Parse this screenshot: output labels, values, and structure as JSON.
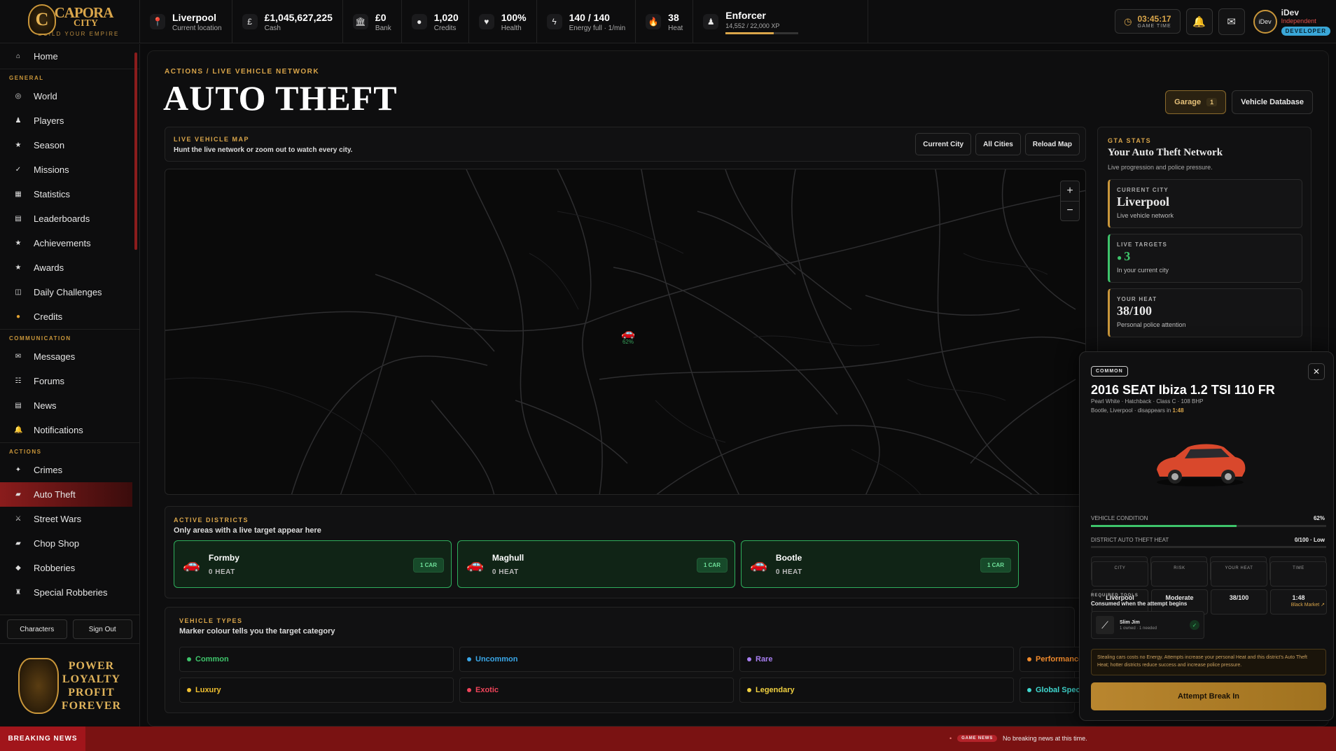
{
  "brand": {
    "name1": "CAPORA",
    "name2": "CITY",
    "tagline": "BUILD YOUR EMPIRE",
    "crest": "C"
  },
  "topbar": {
    "stats": [
      {
        "icon": "location-pin-icon",
        "glyph": "📍",
        "value": "Liverpool",
        "label": "Current location"
      },
      {
        "icon": "pound-icon",
        "glyph": "£",
        "value": "£1,045,627,225",
        "label": "Cash"
      },
      {
        "icon": "bank-icon",
        "glyph": "🏛",
        "value": "£0",
        "label": "Bank"
      },
      {
        "icon": "coin-icon",
        "glyph": "●",
        "value": "1,020",
        "label": "Credits"
      },
      {
        "icon": "heart-icon",
        "glyph": "♥",
        "value": "100%",
        "label": "Health"
      },
      {
        "icon": "energy-icon",
        "glyph": "ϟ",
        "value": "140 / 140",
        "label": "Energy full · 1/min"
      },
      {
        "icon": "flame-icon",
        "glyph": "🔥",
        "value": "38",
        "label": "Heat"
      }
    ],
    "rank": {
      "name": "Enforcer",
      "xp": "14,552 / 22,000 XP",
      "progress": 0.66
    },
    "clock": {
      "time": "03:45:17",
      "label": "GAME TIME"
    },
    "user": {
      "name": "iDev",
      "status": "Independent",
      "role": "DEVELOPER",
      "avatar": "iDev"
    }
  },
  "sidebar": {
    "home": {
      "label": "Home",
      "glyph": "⌂"
    },
    "sections": [
      {
        "title": "GENERAL",
        "items": [
          {
            "label": "World",
            "glyph": "◎",
            "icon": "globe-icon"
          },
          {
            "label": "Players",
            "glyph": "♟",
            "icon": "player-icon"
          },
          {
            "label": "Season",
            "glyph": "★",
            "icon": "star-icon"
          },
          {
            "label": "Missions",
            "glyph": "✓",
            "icon": "check-icon"
          },
          {
            "label": "Statistics",
            "glyph": "▦",
            "icon": "chart-icon"
          },
          {
            "label": "Leaderboards",
            "glyph": "▤",
            "icon": "leaderboard-icon"
          },
          {
            "label": "Achievements",
            "glyph": "★",
            "icon": "trophy-icon"
          },
          {
            "label": "Awards",
            "glyph": "★",
            "icon": "award-icon"
          },
          {
            "label": "Daily Challenges",
            "glyph": "◫",
            "icon": "calendar-icon"
          },
          {
            "label": "Credits",
            "glyph": "●",
            "icon": "coin-icon"
          }
        ]
      },
      {
        "title": "COMMUNICATION",
        "items": [
          {
            "label": "Messages",
            "glyph": "✉",
            "icon": "mail-icon"
          },
          {
            "label": "Forums",
            "glyph": "☷",
            "icon": "forum-icon"
          },
          {
            "label": "News",
            "glyph": "▤",
            "icon": "news-icon"
          },
          {
            "label": "Notifications",
            "glyph": "🔔",
            "icon": "bell-icon"
          }
        ]
      },
      {
        "title": "ACTIONS",
        "items": [
          {
            "label": "Crimes",
            "glyph": "✦",
            "icon": "crime-icon"
          },
          {
            "label": "Auto Theft",
            "glyph": "▰",
            "icon": "car-icon",
            "active": true
          },
          {
            "label": "Street Wars",
            "glyph": "⚔",
            "icon": "swords-icon"
          },
          {
            "label": "Chop Shop",
            "glyph": "▰",
            "icon": "wrench-icon"
          },
          {
            "label": "Robberies",
            "glyph": "◆",
            "icon": "mask-icon"
          },
          {
            "label": "Special Robberies",
            "glyph": "♜",
            "icon": "vault-icon"
          }
        ]
      }
    ],
    "buttons": {
      "characters": "Characters",
      "signout": "Sign Out"
    },
    "motto": [
      "POWER",
      "LOYALTY",
      "PROFIT",
      "FOREVER"
    ]
  },
  "page": {
    "breadcrumb": "ACTIONS / LIVE VEHICLE NETWORK",
    "title": "AUTO THEFT",
    "garage": {
      "label": "Garage",
      "count": "1"
    },
    "database": "Vehicle Database"
  },
  "map": {
    "kicker": "LIVE VEHICLE MAP",
    "desc": "Hunt the live network or zoom out to watch every city.",
    "buttons": [
      "Current City",
      "All Cities",
      "Reload Map"
    ],
    "marker_pct": "62%"
  },
  "districts": {
    "kicker": "ACTIVE DISTRICTS",
    "desc": "Only areas with a live target appear here",
    "items": [
      {
        "name": "Formby",
        "heat": "0 HEAT",
        "count": "1 CAR"
      },
      {
        "name": "Maghull",
        "heat": "0 HEAT",
        "count": "1 CAR"
      },
      {
        "name": "Bootle",
        "heat": "0 HEAT",
        "count": "1 CAR"
      }
    ]
  },
  "vehicle_types": {
    "kicker": "VEHICLE TYPES",
    "desc": "Marker colour tells you the target category",
    "items": [
      {
        "label": "Common",
        "color": "#3ec46b"
      },
      {
        "label": "Uncommon",
        "color": "#3aa7e8"
      },
      {
        "label": "Rare",
        "color": "#a77ef0"
      },
      {
        "label": "Performance",
        "color": "#f08a2c"
      },
      {
        "label": "Luxury",
        "color": "#f0c030"
      },
      {
        "label": "Exotic",
        "color": "#f0445a"
      },
      {
        "label": "Legendary",
        "color": "#f0d040"
      },
      {
        "label": "Global Special",
        "color": "#40d8d0"
      }
    ]
  },
  "gta_stats": {
    "kicker": "GTA STATS",
    "title": "Your Auto Theft Network",
    "sub": "Live progression and police pressure.",
    "cards": [
      {
        "key": "CURRENT CITY",
        "value": "Liverpool",
        "desc": "Live vehicle network"
      },
      {
        "key": "LIVE TARGETS",
        "value": "3",
        "desc": "In your current city"
      },
      {
        "key": "YOUR HEAT",
        "value": "38/100",
        "desc": "Personal police attention"
      }
    ]
  },
  "vehicle": {
    "rarity": "COMMON",
    "name": "2016 SEAT Ibiza 1.2 TSI 110 FR",
    "specs": "Pearl White · Hatchback · Class C · 108 BHP",
    "location": "Bootle, Liverpool · disappears in",
    "timer": "1:48",
    "condition_label": "VEHICLE CONDITION",
    "condition": "62%",
    "condition_value": 0.62,
    "district_heat_label": "DISTRICT AUTO THEFT HEAT",
    "district_heat": "0/100 · Low",
    "district_heat_value": 0.0,
    "info": [
      {
        "key": "CITY",
        "value": "Liverpool"
      },
      {
        "key": "RISK",
        "value": "Moderate"
      },
      {
        "key": "YOUR HEAT",
        "value": "38/100"
      },
      {
        "key": "TIME",
        "value": "1:48"
      }
    ],
    "tools_key": "REQUIRED TOOLS",
    "tools_desc": "Consumed when the attempt begins",
    "market_link": "Black Market ↗",
    "tool": {
      "name": "Slim Jim",
      "qty": "1 owned · 1 needed"
    },
    "warning": "Stealing cars costs no Energy. Attempts increase your personal Heat and this district's Auto Theft Heat; hotter districts reduce success and increase police pressure.",
    "attempt": "Attempt Break In"
  },
  "ticker": {
    "label": "BREAKING NEWS",
    "tag": "GAME NEWS",
    "text": "No breaking news at this time."
  }
}
